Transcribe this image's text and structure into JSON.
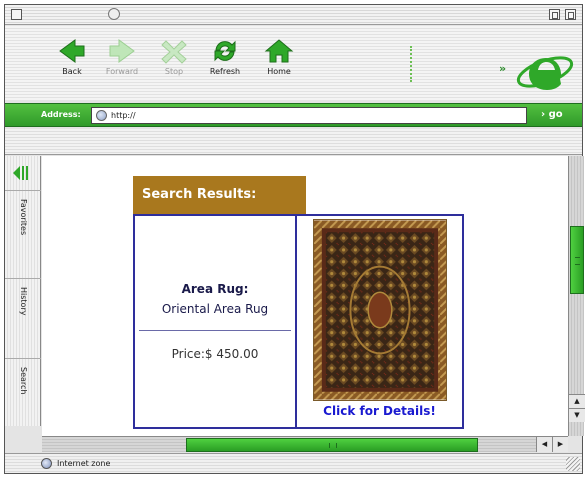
{
  "toolbar": {
    "back_label": "Back",
    "forward_label": "Forward",
    "stop_label": "Stop",
    "refresh_label": "Refresh",
    "home_label": "Home",
    "more_label": "»"
  },
  "address_bar": {
    "label": "Address:",
    "value": "http://",
    "go_label": "go"
  },
  "explorer_bar": {
    "tabs": [
      {
        "label": "Favorites"
      },
      {
        "label": "History"
      },
      {
        "label": "Search"
      }
    ]
  },
  "results": {
    "header": "Search Results:",
    "item_title": "Area Rug:",
    "item_name": "Oriental Area Rug",
    "item_price": "Price:$ 450.00",
    "details_link": "Click for Details!"
  },
  "status_bar": {
    "text": "Internet zone"
  },
  "colors": {
    "accent_green": "#3fb335",
    "header_brown": "#a9781e",
    "table_border": "#2e2e9c",
    "link_blue": "#1a1ad0"
  }
}
